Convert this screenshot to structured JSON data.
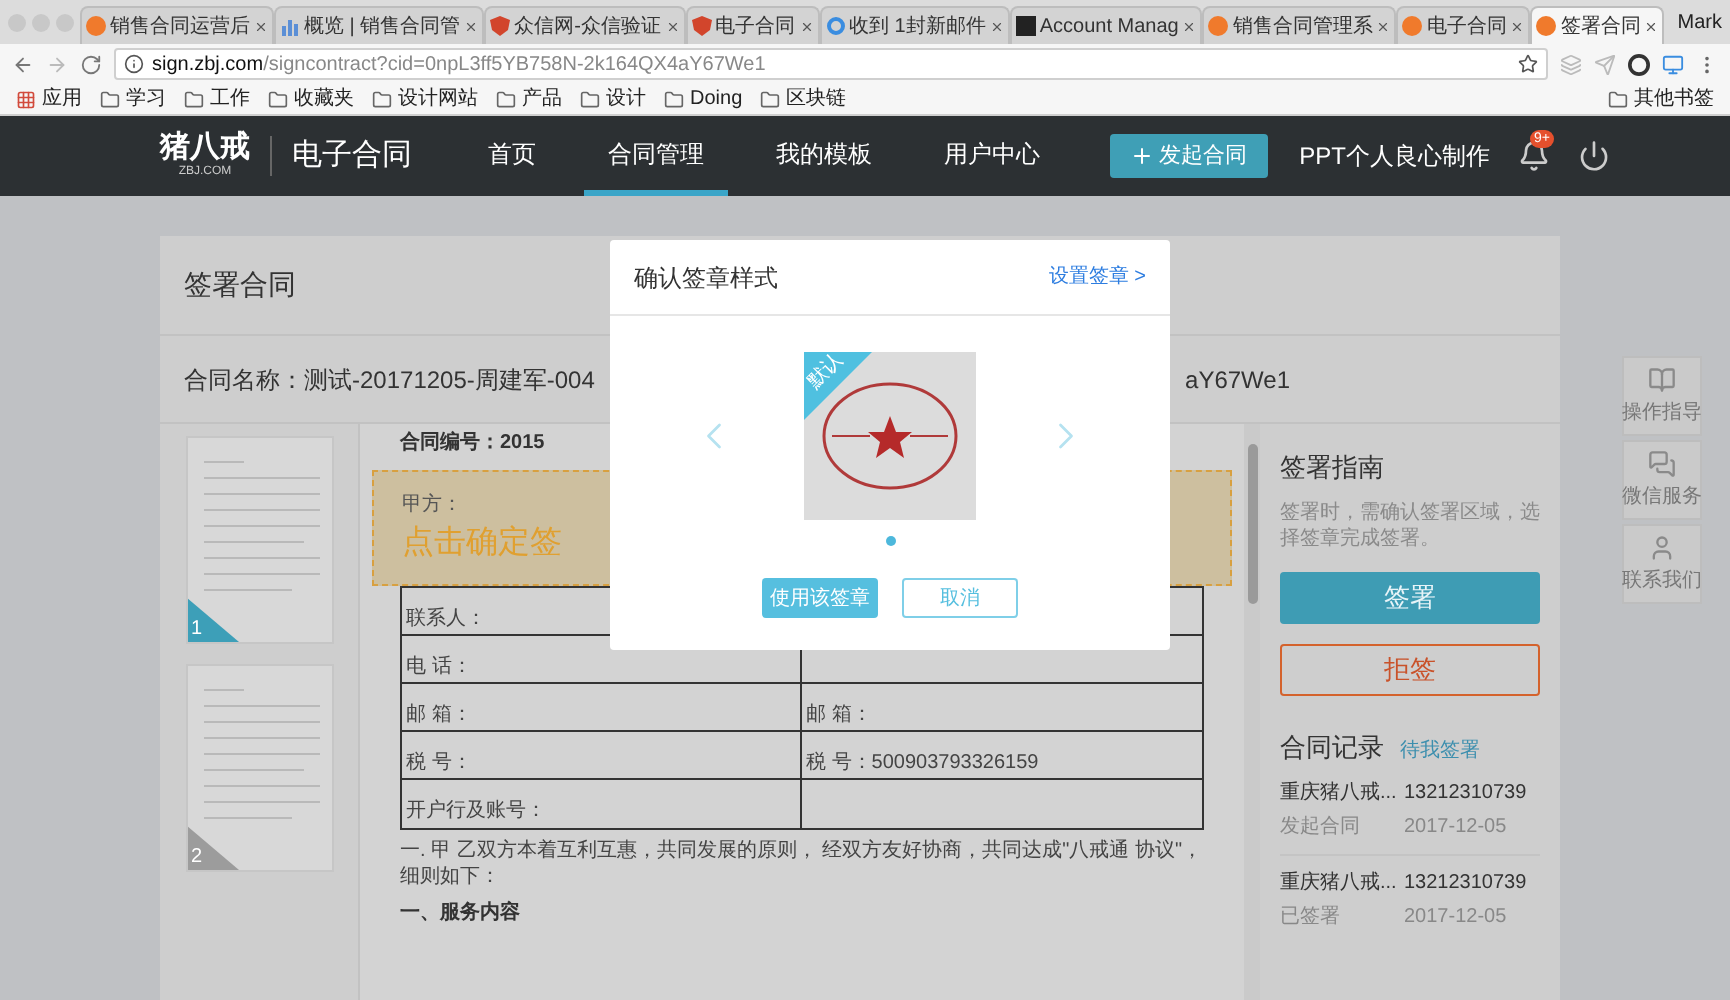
{
  "browser": {
    "tabs": [
      {
        "title": "销售合同运营后",
        "kind": "orange",
        "selected": false
      },
      {
        "title": "概览 | 销售合同管",
        "kind": "chart",
        "selected": false
      },
      {
        "title": "众信网-众信验证",
        "kind": "shield",
        "selected": false
      },
      {
        "title": "电子合同",
        "kind": "shield",
        "selected": false
      },
      {
        "title": "收到 1封新邮件",
        "kind": "ring",
        "selected": false
      },
      {
        "title": "Account Manag",
        "kind": "dark",
        "selected": false
      },
      {
        "title": "销售合同管理系",
        "kind": "orange",
        "selected": false
      },
      {
        "title": "电子合同",
        "kind": "orange",
        "selected": false
      },
      {
        "title": "签署合同",
        "kind": "orange",
        "selected": true
      }
    ],
    "profile": "Mark",
    "url": {
      "host": "sign.zbj.com",
      "path": "/signcontract?cid=0npL3ff5YB758N-2k164QX4aY67We1"
    },
    "bookmarks": [
      {
        "label": "应用",
        "kind": "apps"
      },
      {
        "label": "学习",
        "kind": "folder"
      },
      {
        "label": "工作",
        "kind": "folder"
      },
      {
        "label": "收藏夹",
        "kind": "folder"
      },
      {
        "label": "设计网站",
        "kind": "folder"
      },
      {
        "label": "产品",
        "kind": "folder"
      },
      {
        "label": "设计",
        "kind": "folder"
      },
      {
        "label": "Doing",
        "kind": "folder"
      },
      {
        "label": "区块链",
        "kind": "folder"
      }
    ],
    "other_bookmarks": "其他书签"
  },
  "site_nav": {
    "logo": "猪八戒",
    "logo_sub": "ZBJ.COM",
    "product": "电子合同",
    "items": [
      {
        "label": "首页",
        "selected": false
      },
      {
        "label": "合同管理",
        "selected": true
      },
      {
        "label": "我的模板",
        "selected": false
      },
      {
        "label": "用户中心",
        "selected": false
      }
    ],
    "new_button": "发起合同",
    "user": "PPT个人良心制作",
    "notifications": "9+"
  },
  "page": {
    "title": "签署合同",
    "contract_name": "合同名称：测试-20171205-周建军-004",
    "contract_id": "aY67We1"
  },
  "thumbnails": [
    {
      "page": "1",
      "selected": true
    },
    {
      "page": "2",
      "selected": false
    }
  ],
  "document": {
    "number": "合同编号：2015",
    "party": "甲方：",
    "sign_prompt": "点击确定签",
    "rows": [
      {
        "left": "联系人："
      },
      {
        "left": "电 话："
      },
      {
        "left": "邮 箱：",
        "right": "邮 箱："
      },
      {
        "left": "税 号：",
        "right": "税 号：500903793326159"
      },
      {
        "left": "开户行及账号："
      }
    ],
    "paragraph": "一. 甲 乙双方本着互利互惠，共同发展的原则， 经双方友好协商，共同达成\"八戒通 协议\"，细则如下：",
    "heading": "一、服务内容"
  },
  "guide": {
    "title": "签署指南",
    "text": "签署时，需确认签署区域，选择签章完成签署。",
    "sign_button": "签署",
    "reject_button": "拒签"
  },
  "records": {
    "title": "合同记录",
    "link": "待我签署",
    "items": [
      {
        "name": "重庆猪八戒...",
        "phone": "13212310739",
        "action": "发起合同",
        "date": "2017-12-05"
      },
      {
        "name": "重庆猪八戒...",
        "phone": "13212310739",
        "action": "已签署",
        "date": "2017-12-05"
      }
    ]
  },
  "side_tools": [
    {
      "label": "操作指导",
      "kind": "book"
    },
    {
      "label": "微信服务",
      "kind": "chat"
    },
    {
      "label": "联系我们",
      "kind": "person"
    }
  ],
  "dialog": {
    "title": "确认签章样式",
    "link": "设置签章 >",
    "stamps": [
      {
        "badge": "默认",
        "selected": true
      }
    ],
    "confirm": "使用该签章",
    "cancel": "取消"
  }
}
